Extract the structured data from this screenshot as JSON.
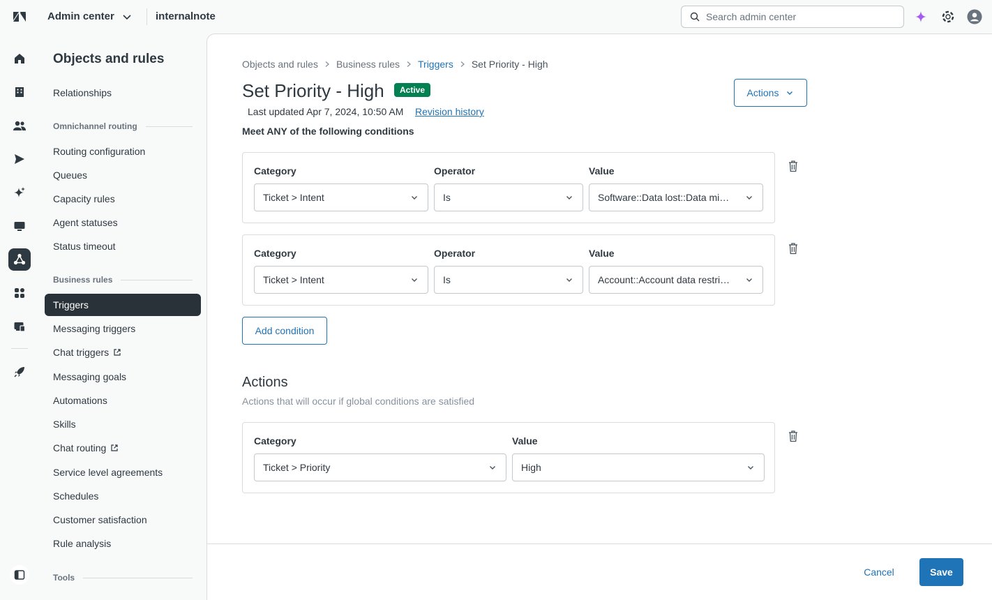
{
  "topbar": {
    "product": "Admin center",
    "account": "internalnote",
    "search_placeholder": "Search admin center",
    "icons": [
      "zendesk-logo-icon",
      "chevron-down-icon",
      "search-icon",
      "sparkle-ai-icon",
      "help-lifebuoy-icon",
      "user-avatar-icon"
    ]
  },
  "rail": {
    "icons": [
      "home-icon",
      "building-icon",
      "people-icon",
      "channels-send-icon",
      "ai-sparkle-icon",
      "workspaces-monitor-icon",
      "objects-rules-icon",
      "apps-integrations-icon",
      "account-icon",
      "rocket-icon",
      "panel-toggle-icon"
    ],
    "active": "objects-rules-icon"
  },
  "nav": {
    "title": "Objects and rules",
    "relationships": "Relationships",
    "omni_heading": "Omnichannel routing",
    "omni_items": [
      "Routing configuration",
      "Queues",
      "Capacity rules",
      "Agent statuses",
      "Status timeout"
    ],
    "business_heading": "Business rules",
    "business_items": [
      "Triggers",
      "Messaging triggers",
      "Chat triggers",
      "Messaging goals",
      "Automations",
      "Skills",
      "Chat routing",
      "Service level agreements",
      "Schedules",
      "Customer satisfaction",
      "Rule analysis"
    ],
    "tools_heading": "Tools",
    "active_item": "Triggers"
  },
  "breadcrumb": [
    "Objects and rules",
    "Business rules",
    "Triggers",
    "Set Priority - High"
  ],
  "page": {
    "title": "Set Priority - High",
    "status": "Active",
    "actions_label": "Actions",
    "last_updated": "Last updated Apr 7, 2024, 10:50 AM",
    "revision_link": "Revision history",
    "conditions_heading": "Meet ANY of the following conditions",
    "add_condition": "Add condition"
  },
  "labels": {
    "category": "Category",
    "operator": "Operator",
    "value": "Value"
  },
  "conditions": [
    {
      "category": "Ticket > Intent",
      "operator": "Is",
      "value": "Software::Data lost::Data missing"
    },
    {
      "category": "Ticket > Intent",
      "operator": "Is",
      "value": "Account::Account data restriction"
    }
  ],
  "actions_section": {
    "title": "Actions",
    "description": "Actions that will occur if global conditions are satisfied",
    "items": [
      {
        "category": "Ticket > Priority",
        "value": "High"
      }
    ]
  },
  "footer": {
    "cancel": "Cancel",
    "save": "Save"
  },
  "colors": {
    "accent": "#1f73b7",
    "active_badge": "#038153",
    "nav_active": "#293239"
  }
}
